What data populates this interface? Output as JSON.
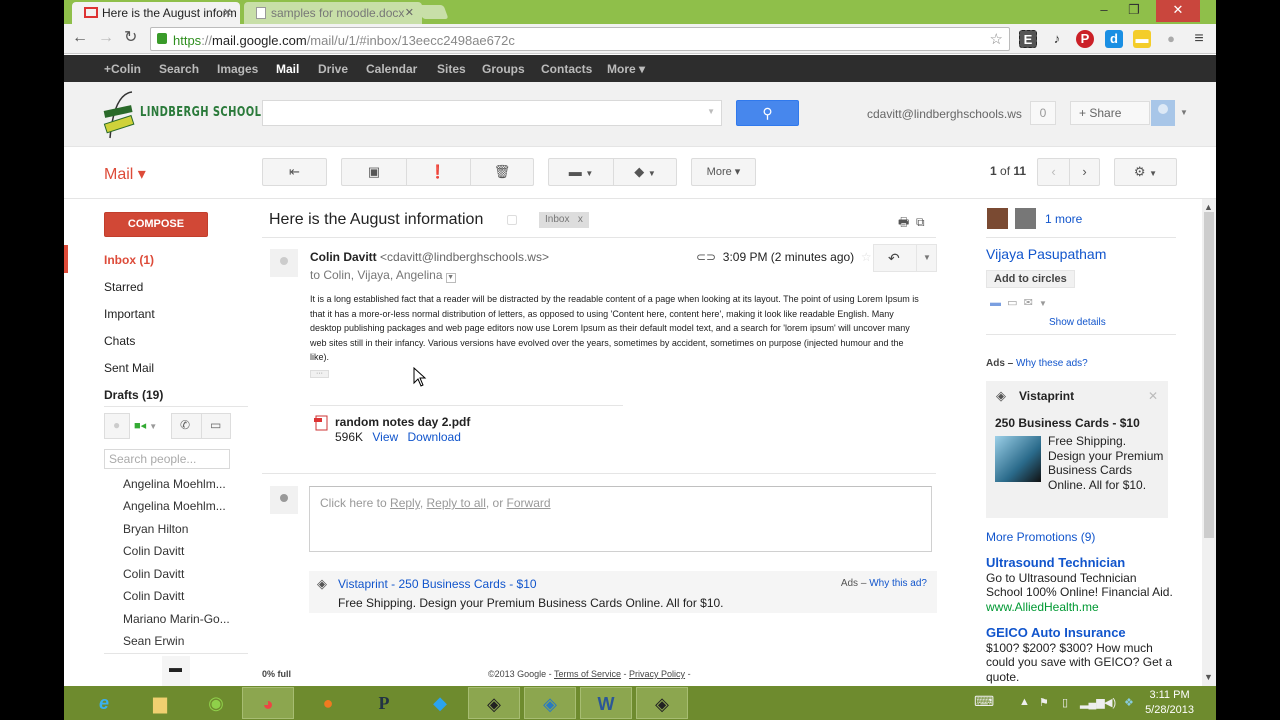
{
  "browser": {
    "tabs": [
      {
        "title": "Here is the August inform",
        "icon": "gmail-icon",
        "active": true
      },
      {
        "title": "samples for moodle.docx",
        "icon": "document-icon",
        "active": false
      }
    ],
    "url": {
      "scheme": "https",
      "host": "mail.google.com",
      "path": "/mail/u/1/#inbox/13eecc2498ae672c"
    },
    "window_controls": {
      "minimize": "–",
      "maximize": "❐",
      "close": "✕"
    }
  },
  "gbar": {
    "items": [
      "+Colin",
      "Search",
      "Images",
      "Mail",
      "Drive",
      "Calendar",
      "Sites",
      "Groups",
      "Contacts",
      "More ▾"
    ],
    "current": "Mail"
  },
  "header": {
    "logo_text": "LINDBERGH SCHOOLS",
    "search_placeholder": "",
    "account_email": "cdavitt@lindberghschools.ws",
    "notification_count": "0",
    "share_label": "+ Share"
  },
  "actionbar": {
    "app_label": "Mail ▾",
    "more_label": "More ▾",
    "pager": {
      "current": "1",
      "separator": "of",
      "total": "11"
    }
  },
  "sidebar": {
    "compose_label": "COMPOSE",
    "nav": [
      {
        "label": "Inbox (1)",
        "selected": true
      },
      {
        "label": "Starred"
      },
      {
        "label": "Important"
      },
      {
        "label": "Chats"
      },
      {
        "label": "Sent Mail"
      },
      {
        "label": "Drafts (19)",
        "bold": true
      }
    ],
    "people_search_placeholder": "Search people...",
    "contacts": [
      "Angelina Moehlm...",
      "Angelina Moehlm...",
      "Bryan Hilton",
      "Colin Davitt",
      "Colin Davitt",
      "Colin Davitt",
      "Mariano Marin-Go...",
      "Sean Erwin"
    ]
  },
  "message": {
    "subject": "Here is the August information",
    "label": "Inbox",
    "label_remove": "x",
    "sender_name": "Colin Davitt",
    "sender_email": "<cdavitt@lindberghschools.ws>",
    "recipients": "to Colin, Vijaya, Angelina",
    "time": "3:09 PM (2 minutes ago)",
    "body": "It is a long established fact that a reader will be distracted by the readable content of a page when looking at its layout. The point of using Lorem Ipsum is that it has a more-or-less normal distribution of letters, as opposed to using 'Content here, content here', making it look like readable English. Many desktop publishing packages and web page editors now use Lorem Ipsum as their default model text, and a search for 'lorem ipsum' will uncover many web sites still in their infancy. Various versions have evolved over the years, sometimes by accident, sometimes on purpose (injected humour and the like).",
    "attachment": {
      "name": "random notes day 2.pdf",
      "size": "596K",
      "view_label": "View",
      "download_label": "Download"
    },
    "reply_prompt": {
      "prefix": "Click here to ",
      "reply": "Reply",
      "sep1": ", ",
      "reply_all": "Reply to all",
      "sep2": ", or ",
      "forward": "Forward"
    }
  },
  "inline_ad": {
    "title": "Vistaprint - 250 Business Cards - $10",
    "description": "Free Shipping. Design your Premium Business Cards Online. All for $10.",
    "ads_label": "Ads – ",
    "why_label": "Why this ad?"
  },
  "footer": {
    "storage": "0% full",
    "copyright": "©2013 Google - ",
    "terms": "Terms of Service",
    "sep": " - ",
    "privacy": "Privacy Policy",
    "tail": " -"
  },
  "right_pane": {
    "more_people": "1 more",
    "contact_name": "Vijaya Pasupatham",
    "add_circles": "Add to circles",
    "show_details": "Show details",
    "ads_label": "Ads – ",
    "why_ads": "Why these ads?",
    "ad_card": {
      "brand": "Vistaprint",
      "headline": "250 Business Cards - $10",
      "text": "Free Shipping. Design your Premium Business Cards Online. All for $10."
    },
    "more_promotions": "More Promotions (9)",
    "text_ads": [
      {
        "headline": "Ultrasound Technician",
        "text": "Go to Ultrasound Technician School 100% Online! Financial Aid.",
        "url": "www.AlliedHealth.me"
      },
      {
        "headline": "GEICO Auto Insurance",
        "text": "$100? $200? $300? How much could you save with GEICO? Get a quote.",
        "url": ""
      }
    ]
  },
  "taskbar": {
    "apps": [
      "Internet Explorer",
      "File Explorer",
      "Evernote",
      "Google Chrome",
      "Firefox",
      "Publisher",
      "Twitter",
      "App",
      "App",
      "Word",
      "Recorder"
    ],
    "active_app": "Google Chrome",
    "clock_time": "3:11 PM",
    "clock_date": "5/28/2013"
  },
  "colors": {
    "accent_red": "#dd4b39",
    "compose_red": "#d14836",
    "search_blue": "#4787ed",
    "link_blue": "#1155cc",
    "taskbar_green": "#6e8b2e"
  }
}
